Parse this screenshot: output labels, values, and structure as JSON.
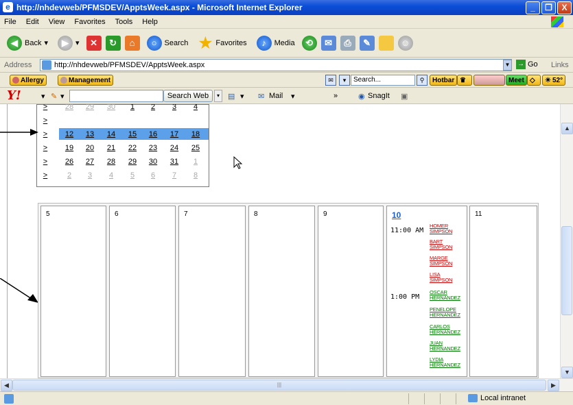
{
  "window": {
    "title": "http://nhdevweb/PFMSDEV/ApptsWeek.aspx - Microsoft Internet Explorer",
    "buttons": [
      "_",
      "❐",
      "X"
    ]
  },
  "menu": [
    "File",
    "Edit",
    "View",
    "Favorites",
    "Tools",
    "Help"
  ],
  "toolbar": {
    "back": "Back",
    "search": "Search",
    "favorites": "Favorites",
    "media": "Media"
  },
  "address": {
    "label": "Address",
    "url": "http://nhdevweb/PFMSDEV/ApptsWeek.aspx",
    "go": "Go",
    "links": "Links"
  },
  "linksbar": {
    "allergy": "Allergy",
    "management": "Management",
    "search_placeholder": "Search...",
    "hotbar": "Hotbar",
    "meet": "Meet",
    "temp": "52°"
  },
  "yahoobar": {
    "logo": "Y!",
    "search_button": "Search Web",
    "mail": "Mail",
    "more": "»",
    "snagit": "SnagIt"
  },
  "calendar_popup": {
    "selector": ">",
    "rows": [
      {
        "days": [
          "28",
          "29",
          "30",
          "1",
          "2",
          "3",
          "4"
        ],
        "dim": [
          true,
          true,
          true,
          false,
          false,
          false,
          false
        ],
        "highlight": false,
        "partial": true
      },
      {
        "days": [
          "5",
          "6",
          "7",
          "8",
          "9",
          "10",
          "11"
        ],
        "dim": [
          false,
          false,
          false,
          false,
          false,
          false,
          false
        ],
        "highlight": true
      },
      {
        "days": [
          "12",
          "13",
          "14",
          "15",
          "16",
          "17",
          "18"
        ],
        "dim": [
          false,
          false,
          false,
          false,
          false,
          false,
          false
        ],
        "highlight": false
      },
      {
        "days": [
          "19",
          "20",
          "21",
          "22",
          "23",
          "24",
          "25"
        ],
        "dim": [
          false,
          false,
          false,
          false,
          false,
          false,
          false
        ],
        "highlight": false
      },
      {
        "days": [
          "26",
          "27",
          "28",
          "29",
          "30",
          "31",
          "1"
        ],
        "dim": [
          false,
          false,
          false,
          false,
          false,
          false,
          true
        ],
        "highlight": false
      },
      {
        "days": [
          "2",
          "3",
          "4",
          "5",
          "6",
          "7",
          "8"
        ],
        "dim": [
          true,
          true,
          true,
          true,
          true,
          true,
          true
        ],
        "highlight": false
      }
    ]
  },
  "week": {
    "days": [
      "5",
      "6",
      "7",
      "8",
      "9",
      "10",
      "11"
    ],
    "today_label": "10",
    "appointments": {
      "time1": "11:00 AM",
      "time2": "1:00 PM",
      "group1": [
        "HOMER",
        "SIMPSON",
        "BART",
        "SIMPSON",
        "MARGE",
        "SIMPSON",
        "LISA",
        "SIMPSON"
      ],
      "group2": [
        "OSCAR",
        "HERNANDEZ",
        "PENELOPE",
        "HERNANDEZ",
        "CARLOS",
        "HERNANDEZ",
        "JUAN",
        "HERNANDEZ",
        "LYDIA",
        "HERNANDEZ"
      ]
    }
  },
  "status": {
    "zone": "Local intranet"
  },
  "colors": {
    "titlebar": "#0b4ed8",
    "highlight": "#5ba0e8",
    "red_appt": "#cc0000",
    "green_appt": "#007700",
    "today": "#1d5fc7"
  }
}
